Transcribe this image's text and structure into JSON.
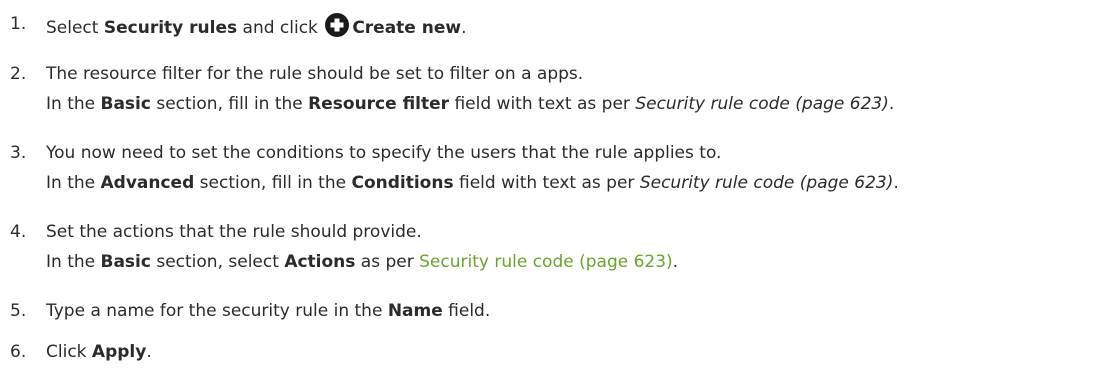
{
  "steps": [
    {
      "number": "1.",
      "lines": [
        {
          "p1": "Select ",
          "b1": "Security rules",
          "p2": " and click ",
          "icon": "plus-circle-icon",
          "b2": "Create new",
          "p3": "."
        }
      ]
    },
    {
      "number": "2.",
      "lines": [
        {
          "text": "The resource filter for the rule should be set to filter on a apps."
        },
        {
          "p1": "In the ",
          "b1": "Basic",
          "p2": " section, fill in the ",
          "b2": "Resource filter",
          "p3": " field with text as per ",
          "i1": "Security rule code (page 623)",
          "p4": "."
        }
      ]
    },
    {
      "number": "3.",
      "lines": [
        {
          "text": "You now need to set the conditions to specify the users that the rule applies to."
        },
        {
          "p1": "In the ",
          "b1": "Advanced",
          "p2": " section, fill in the ",
          "b2": "Conditions",
          "p3": " field with text as per ",
          "i1": "Security rule code (page 623)",
          "p4": "."
        }
      ]
    },
    {
      "number": "4.",
      "lines": [
        {
          "text": "Set the actions that the rule should provide."
        },
        {
          "p1": "In the ",
          "b1": "Basic",
          "p2": " section, select ",
          "b2": "Actions",
          "p3": " as per ",
          "link": "Security rule code (page 623)",
          "p4": "."
        }
      ]
    },
    {
      "number": "5.",
      "lines": [
        {
          "p1": "Type a name for the security rule in the ",
          "b1": "Name",
          "p2": " field."
        }
      ]
    },
    {
      "number": "6.",
      "lines": [
        {
          "p1": "Click ",
          "b1": "Apply",
          "p2": "."
        }
      ]
    }
  ],
  "colors": {
    "text": "#2b2b2b",
    "link": "#6aa42c"
  }
}
